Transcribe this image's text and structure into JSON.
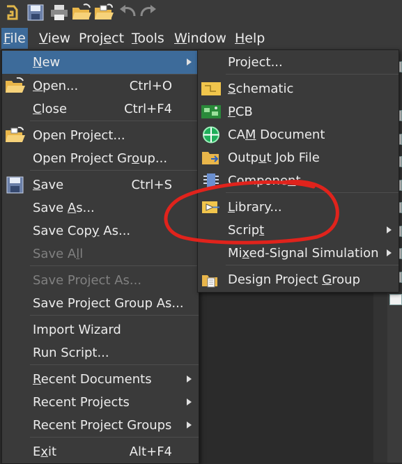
{
  "menubar": {
    "items": [
      {
        "label": "File",
        "mnemonic": "F",
        "rest": "ile"
      },
      {
        "label": "View",
        "mnemonic": "V",
        "rest": "iew"
      },
      {
        "label": "Project",
        "pre": "Proj",
        "mnemonic": "e",
        "rest": "ct"
      },
      {
        "label": "Tools",
        "mnemonic": "T",
        "rest": "ools"
      },
      {
        "label": "Window",
        "mnemonic": "W",
        "rest": "indow"
      },
      {
        "label": "Help",
        "mnemonic": "H",
        "rest": "elp"
      }
    ]
  },
  "file_menu": {
    "new": {
      "label": "New"
    },
    "open": {
      "label": "Open...",
      "shortcut": "Ctrl+O"
    },
    "close": {
      "label": "Close",
      "shortcut": "Ctrl+F4"
    },
    "open_project": {
      "label": "Open Project..."
    },
    "open_project_group": {
      "label": "Open Project Group..."
    },
    "save": {
      "label": "Save",
      "shortcut": "Ctrl+S"
    },
    "save_as": {
      "label": "Save As..."
    },
    "save_copy_as": {
      "label": "Save Copy As..."
    },
    "save_all": {
      "label": "Save All"
    },
    "save_project_as": {
      "label": "Save Project As..."
    },
    "save_project_group_as": {
      "label": "Save Project Group As..."
    },
    "import_wizard": {
      "label": "Import Wizard"
    },
    "run_script": {
      "label": "Run Script..."
    },
    "recent_documents": {
      "label": "Recent Documents"
    },
    "recent_projects": {
      "label": "Recent Projects"
    },
    "recent_project_groups": {
      "label": "Recent Project Groups"
    },
    "exit": {
      "label": "Exit",
      "shortcut": "Alt+F4"
    }
  },
  "new_menu": {
    "project": {
      "label": "Project..."
    },
    "schematic": {
      "label": "Schematic"
    },
    "pcb": {
      "label": "PCB"
    },
    "cam_document": {
      "label": "CAM Document"
    },
    "output_job_file": {
      "label": "Output Job File"
    },
    "component": {
      "label": "Component..."
    },
    "library": {
      "label": "Library..."
    },
    "script": {
      "label": "Script"
    },
    "mixed_signal_simulation": {
      "label": "Mixed-Signal Simulation"
    },
    "design_project_group": {
      "label": "Design Project Group"
    }
  },
  "colors": {
    "menu_bg": "#3a3a3a",
    "highlight": "#3d6b9a",
    "text": "#ececec",
    "disabled_text": "#808080",
    "annotation_red": "#e0231c"
  },
  "icons": [
    "app-logo-icon",
    "save-icon",
    "print-icon",
    "open-folder-icon",
    "open-project-icon",
    "undo-icon",
    "redo-icon"
  ]
}
